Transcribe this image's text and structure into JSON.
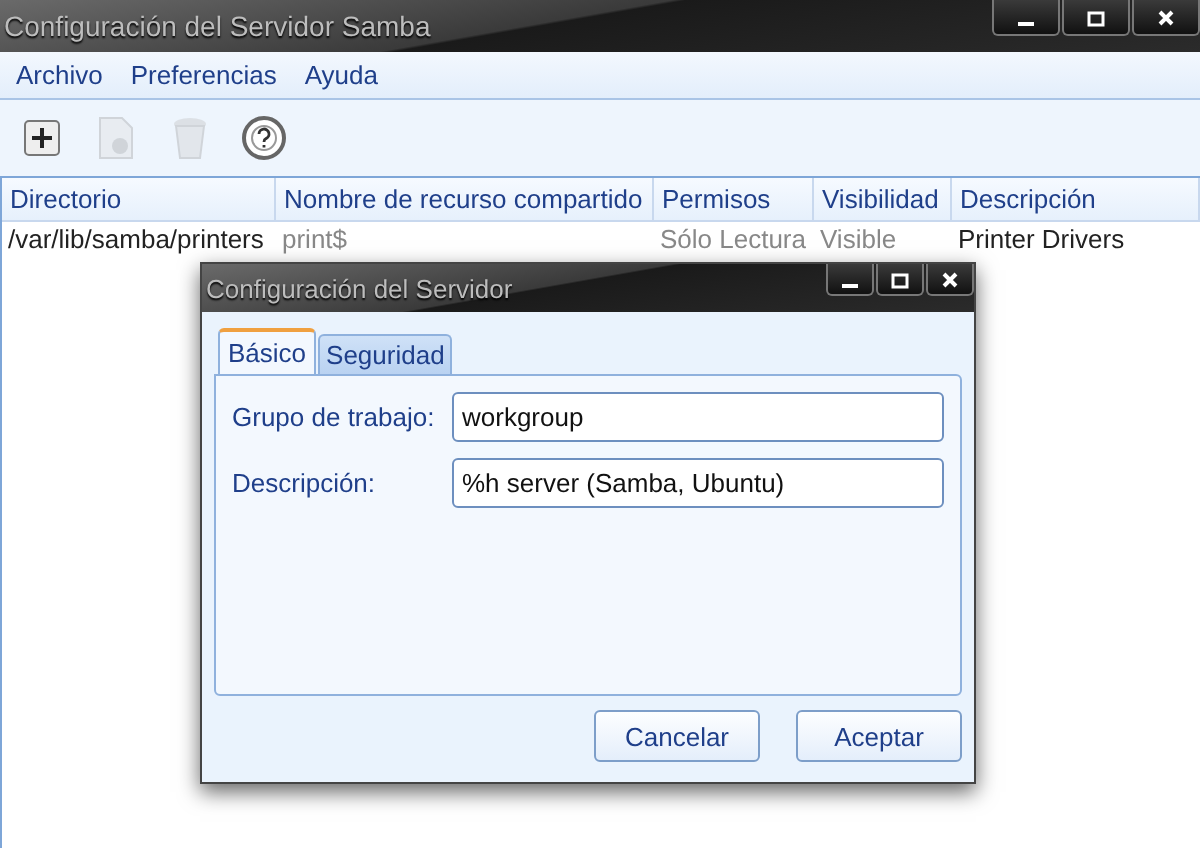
{
  "window": {
    "title": "Configuración del Servidor Samba"
  },
  "menu": [
    "Archivo",
    "Preferencias",
    "Ayuda"
  ],
  "toolbar": [
    {
      "kind": "add",
      "disabled": false
    },
    {
      "kind": "properties",
      "disabled": true
    },
    {
      "kind": "delete",
      "disabled": true
    },
    {
      "kind": "help",
      "disabled": false
    }
  ],
  "table": {
    "columns": [
      "Directorio",
      "Nombre de recurso compartido",
      "Permisos",
      "Visibilidad",
      "Descripción"
    ],
    "rows": [
      {
        "cells": [
          "/var/lib/samba/printers",
          "print$",
          "Sólo Lectura",
          "Visible",
          "Printer Drivers"
        ],
        "selected": false
      }
    ]
  },
  "dialog": {
    "title": "Configuración del Servidor",
    "tabs": [
      {
        "label": "Básico",
        "selected": true
      },
      {
        "label": "Seguridad",
        "selected": false
      }
    ],
    "fields": [
      {
        "label": "Grupo de trabajo:",
        "value": "workgroup"
      },
      {
        "label": "Descripción:",
        "value": "%h server (Samba, Ubuntu)"
      }
    ],
    "buttons": [
      "Cancelar",
      "Aceptar"
    ]
  }
}
